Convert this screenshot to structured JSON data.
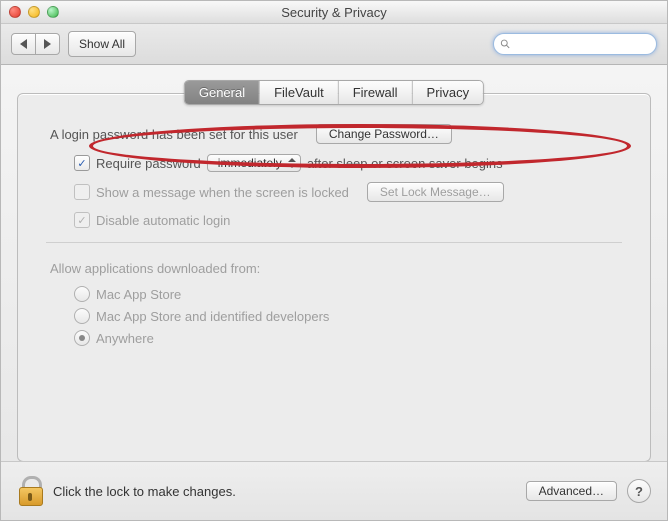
{
  "window": {
    "title": "Security & Privacy"
  },
  "toolbar": {
    "show_all": "Show All",
    "search_placeholder": ""
  },
  "tabs": [
    "General",
    "FileVault",
    "Firewall",
    "Privacy"
  ],
  "general": {
    "login_pw_set": "A login password has been set for this user",
    "change_password": "Change Password…",
    "require_password_before": "Require password",
    "require_password_dropdown": "immediately",
    "require_password_after": "after sleep or screen saver begins",
    "show_message": "Show a message when the screen is locked",
    "set_lock_message": "Set Lock Message…",
    "disable_auto_login": "Disable automatic login",
    "allow_heading": "Allow applications downloaded from:",
    "radios": [
      "Mac App Store",
      "Mac App Store and identified developers",
      "Anywhere"
    ],
    "selected_radio": 2,
    "require_checked": true,
    "show_message_checked": false,
    "disable_auto_checked": true
  },
  "footer": {
    "lock_text": "Click the lock to make changes.",
    "advanced": "Advanced…"
  }
}
